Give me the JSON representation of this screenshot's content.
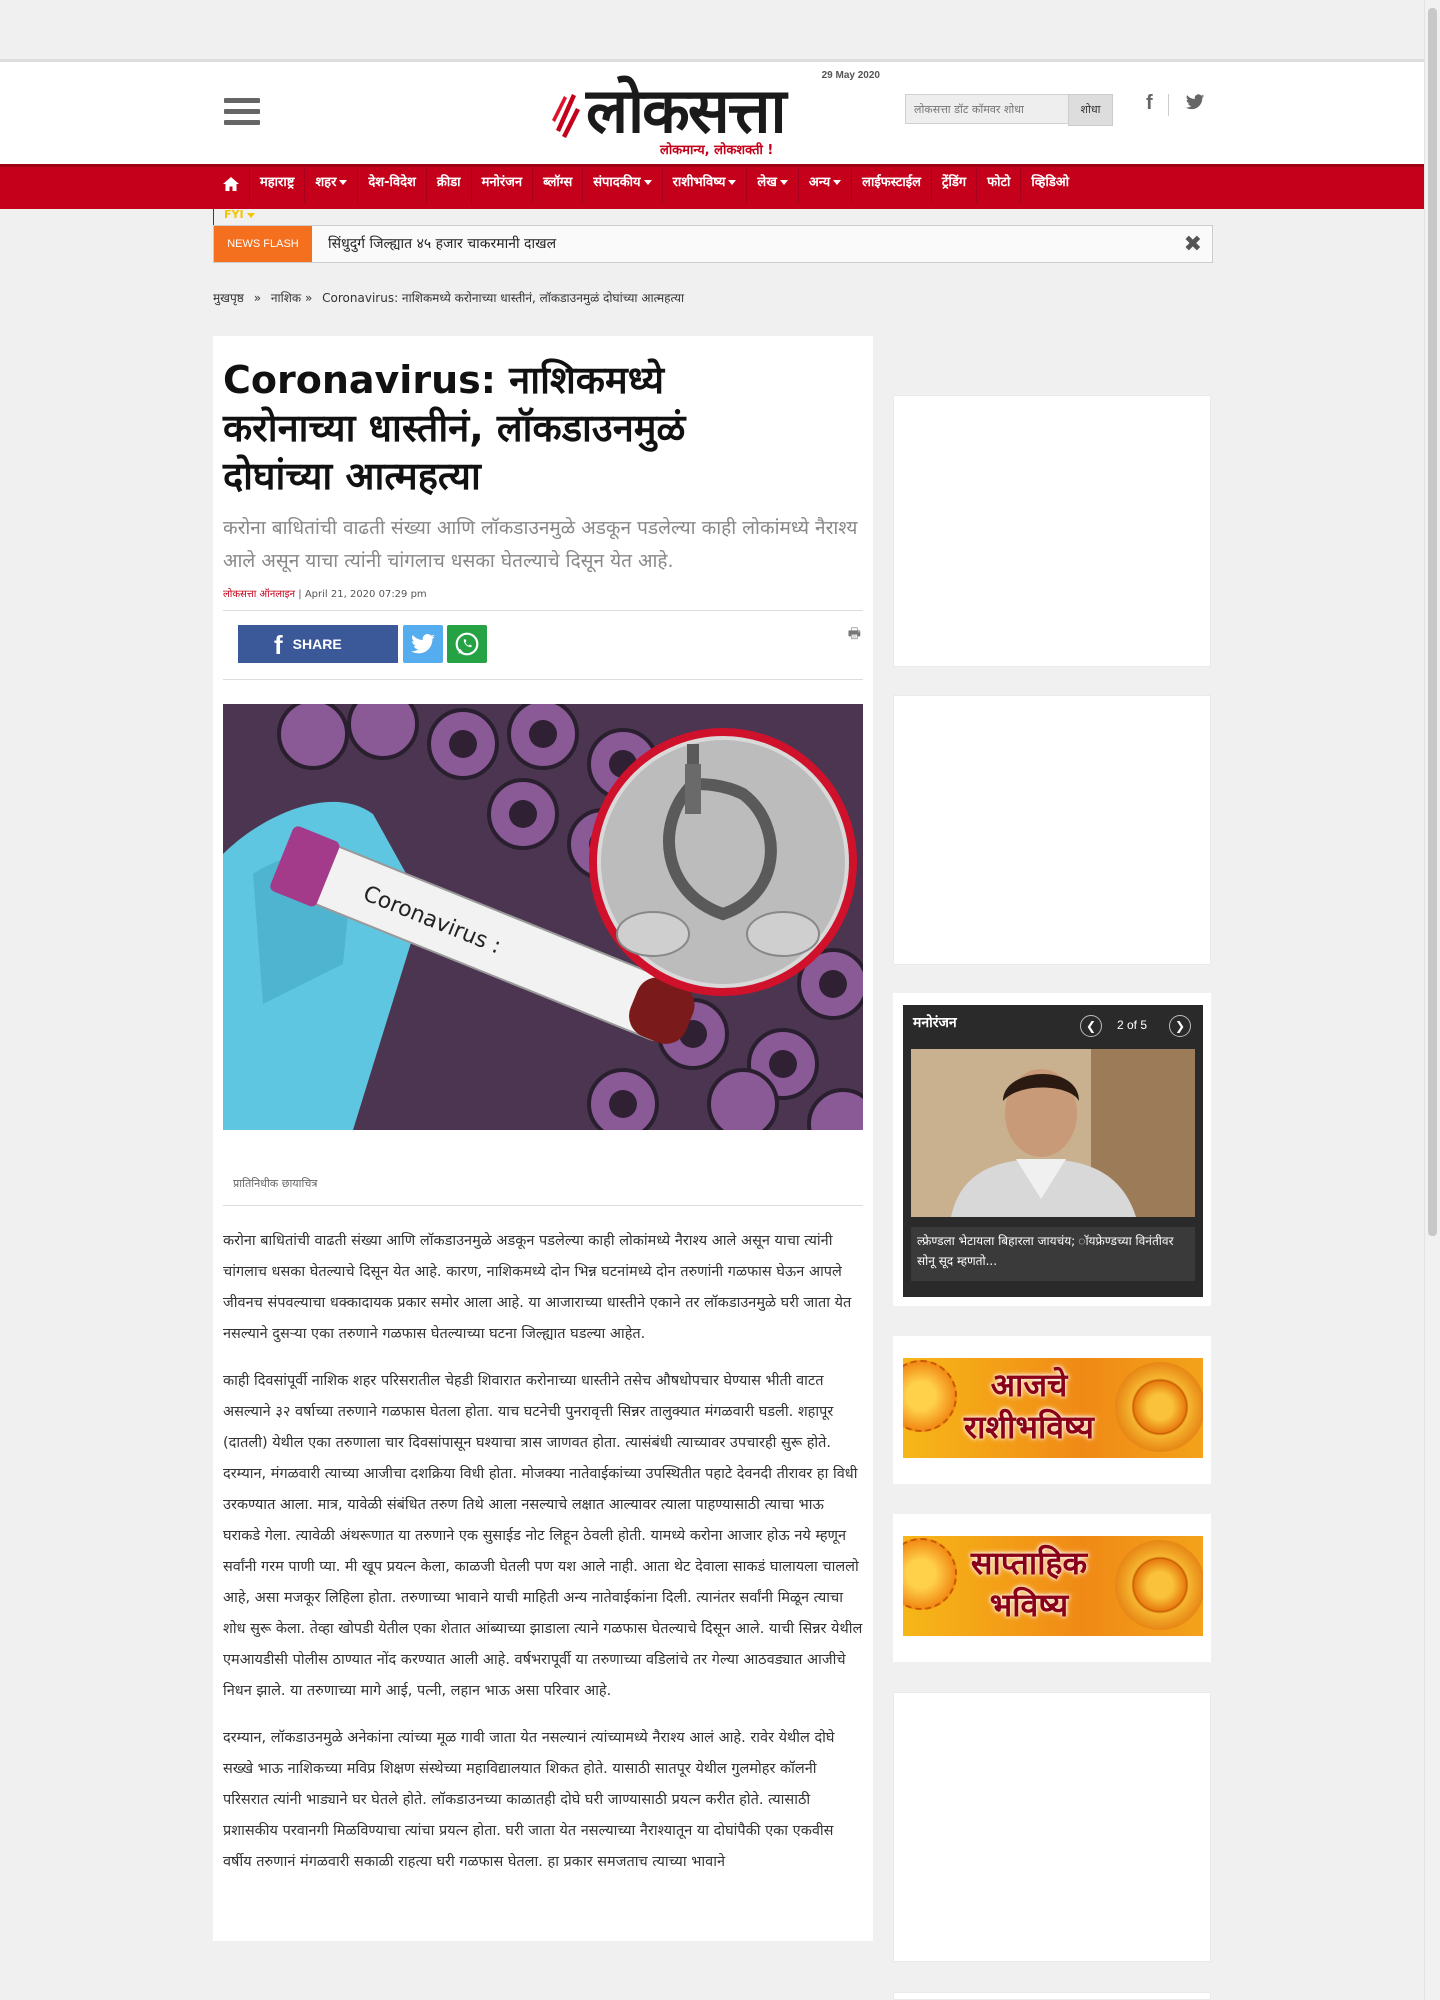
{
  "header": {
    "date": "29 May 2020",
    "logo_text": "लोकसत्ता",
    "logo_tagline": "लोकमान्य, लोकशक्ती !",
    "search_placeholder": "लोकसत्ता डॉट कॉमवर शोधा",
    "search_button": "शोधा"
  },
  "nav": {
    "items": [
      "महाराष्ट्र",
      "शहर",
      "देश-विदेश",
      "क्रीडा",
      "मनोरंजन",
      "ब्लॉग्स",
      "संपादकीय",
      "राशीभविष्य",
      "लेख",
      "अन्य",
      "लाईफस्टाईल",
      "ट्रेंडिंग",
      "फोटो",
      "व्हिडिओ"
    ],
    "fyi": "FYI"
  },
  "newsflash": {
    "tag": "NEWS FLASH",
    "text": "सिंधुदुर्ग जिल्ह्यात ४५ हजार चाकरमानी दाखल"
  },
  "breadcrumb": {
    "home": "मुखपृष्ठ",
    "sep1": "»",
    "section": "नाशिक",
    "sep2": "»",
    "current": "Coronavirus: नाशिकमध्ये करोनाच्या धास्तीनं, लॉकडाउनमुळं दोघांच्या आत्महत्या"
  },
  "article": {
    "title": "Coronavirus: नाशिकमध्ये करोनाच्या धास्तीनं, लॉकडाउनमुळं दोघांच्या आत्महत्या",
    "summary": "करोना बाधितांची वाढती संख्या आणि लॉकडाउनमुळे अडकून पडलेल्या काही लोकांमध्ये नैराश्य आले असून याचा त्यांनी चांगलाच धसका घेतल्याचे दिसून येत आहे.",
    "author": "लोकसत्ता ऑनलाइन",
    "date": "| April 21, 2020 07:29 pm",
    "share_label": "SHARE",
    "image_label": "Coronavirus :",
    "caption": "प्रातिनिधीक छायाचित्र",
    "paragraphs": [
      "करोना बाधितांची वाढती संख्या आणि लॉकडाउनमुळे अडकून पडलेल्या काही लोकांमध्ये नैराश्य आले असून याचा त्यांनी चांगलाच धसका घेतल्याचे दिसून येत आहे. कारण, नाशिकमध्ये दोन भिन्न घटनांमध्ये दोन तरुणांनी गळफास घेऊन आपले जीवनच संपवल्याचा धक्कादायक प्रकार समोर आला आहे. या आजाराच्या धास्तीने एकाने तर लॉकडाउनमुळे घरी जाता येत नसल्याने दुसऱ्या एका तरुणाने गळफास घेतल्याच्या घटना जिल्ह्यात घडल्या आहेत.",
      "काही दिवसांपूर्वी नाशिक शहर परिसरातील चेहडी शिवारात करोनाच्या धास्तीने तसेच औषधोपचार घेण्यास भीती वाटत असल्याने ३२ वर्षाच्या तरुणाने गळफास घेतला होता. याच घटनेची पुनरावृत्ती सिन्नर तालुक्यात मंगळवारी घडली. शहापूर (दातली) येथील एका तरुणाला चार दिवसांपासून घश्याचा त्रास जाणवत होता. त्यासंबंधी त्याच्यावर उपचारही सुरू होते. दरम्यान, मंगळवारी त्याच्या आजीचा दशक्रिया विधी होता. मोजक्या नातेवाईकांच्या उपस्थितीत पहाटे देवनदी तीरावर हा विधी उरकण्यात आला. मात्र, यावेळी संबंधित तरुण तिथे आला नसल्याचे लक्षात आल्यावर त्याला पाहण्यासाठी त्याचा भाऊ घराकडे गेला. त्यावेळी अंथरूणात या तरुणाने एक सुसाईड नोट लिहून ठेवली होती. यामध्ये करोना आजार होऊ नये म्हणून सर्वांनी गरम पाणी प्या. मी खूप प्रयत्न केला, काळजी घेतली पण यश आले नाही. आता थेट देवाला साकडं घालायला चाललो आहे, असा मजकूर लिहिला होता. तरुणाच्या भावाने याची माहिती अन्य नातेवाईकांना दिली. त्यानंतर सर्वांनी मिळून त्याचा शोध सुरू केला. तेव्हा खोपडी येतील एका शेतात आंब्याच्या झाडाला त्याने गळफास घेतल्याचे दिसून आले. याची सिन्नर येथील एमआयडीसी पोलीस ठाण्यात नोंद करण्यात आली आहे. वर्षभरापूर्वी या तरुणाच्या वडिलांचे तर गेल्या आठवड्यात आजीचे निधन झाले. या तरुणाच्या मागे आई, पत्नी, लहान भाऊ असा परिवार आहे.",
      "दरम्यान, लॉकडाउनमुळे अनेकांना त्यांच्या मूळ गावी जाता येत नसल्यानं त्यांच्यामध्ये नैराश्य आलं आहे. रावेर येथील दोघे सख्खे भाऊ नाशिकच्या मविप्र शिक्षण संस्थेच्या महाविद्यालयात शिकत होते. यासाठी सातपूर येथील गुलमोहर कॉलनी परिसरात त्यांनी भाड्याने घर घेतले होते. लॉकडाउनच्या काळातही दोघे घरी जाण्यासाठी प्रयत्न करीत होते. त्यासाठी प्रशासकीय परवानगी मिळविण्याचा त्यांचा प्रयत्न होता. घरी जाता येत नसल्याच्या नैराश्यातून या दोघांपैकी एका एकवीस वर्षीय तरुणानं मंगळवारी सकाळी राहत्या घरी गळफास घेतला. हा प्रकार समजताच त्याच्या भावाने"
    ]
  },
  "sidebar": {
    "slider_title": "मनोरंजन",
    "slider_count": "2 of 5",
    "slider_caption": "ल्फ्रेण्डला भेटायला बिहारला जायचंय; ॉयफ्रेण्डच्या विनंतीवर सोनू सूद म्हणतो...",
    "rashi_daily": "आजचे राशीभविष्य",
    "rashi_weekly": "साप्ताहिक भविष्य"
  },
  "colors": {
    "brand_red": "#c4001a",
    "newsflash_orange": "#f46f1e",
    "facebook": "#3b5998",
    "twitter": "#55acee",
    "whatsapp": "#25a244"
  }
}
